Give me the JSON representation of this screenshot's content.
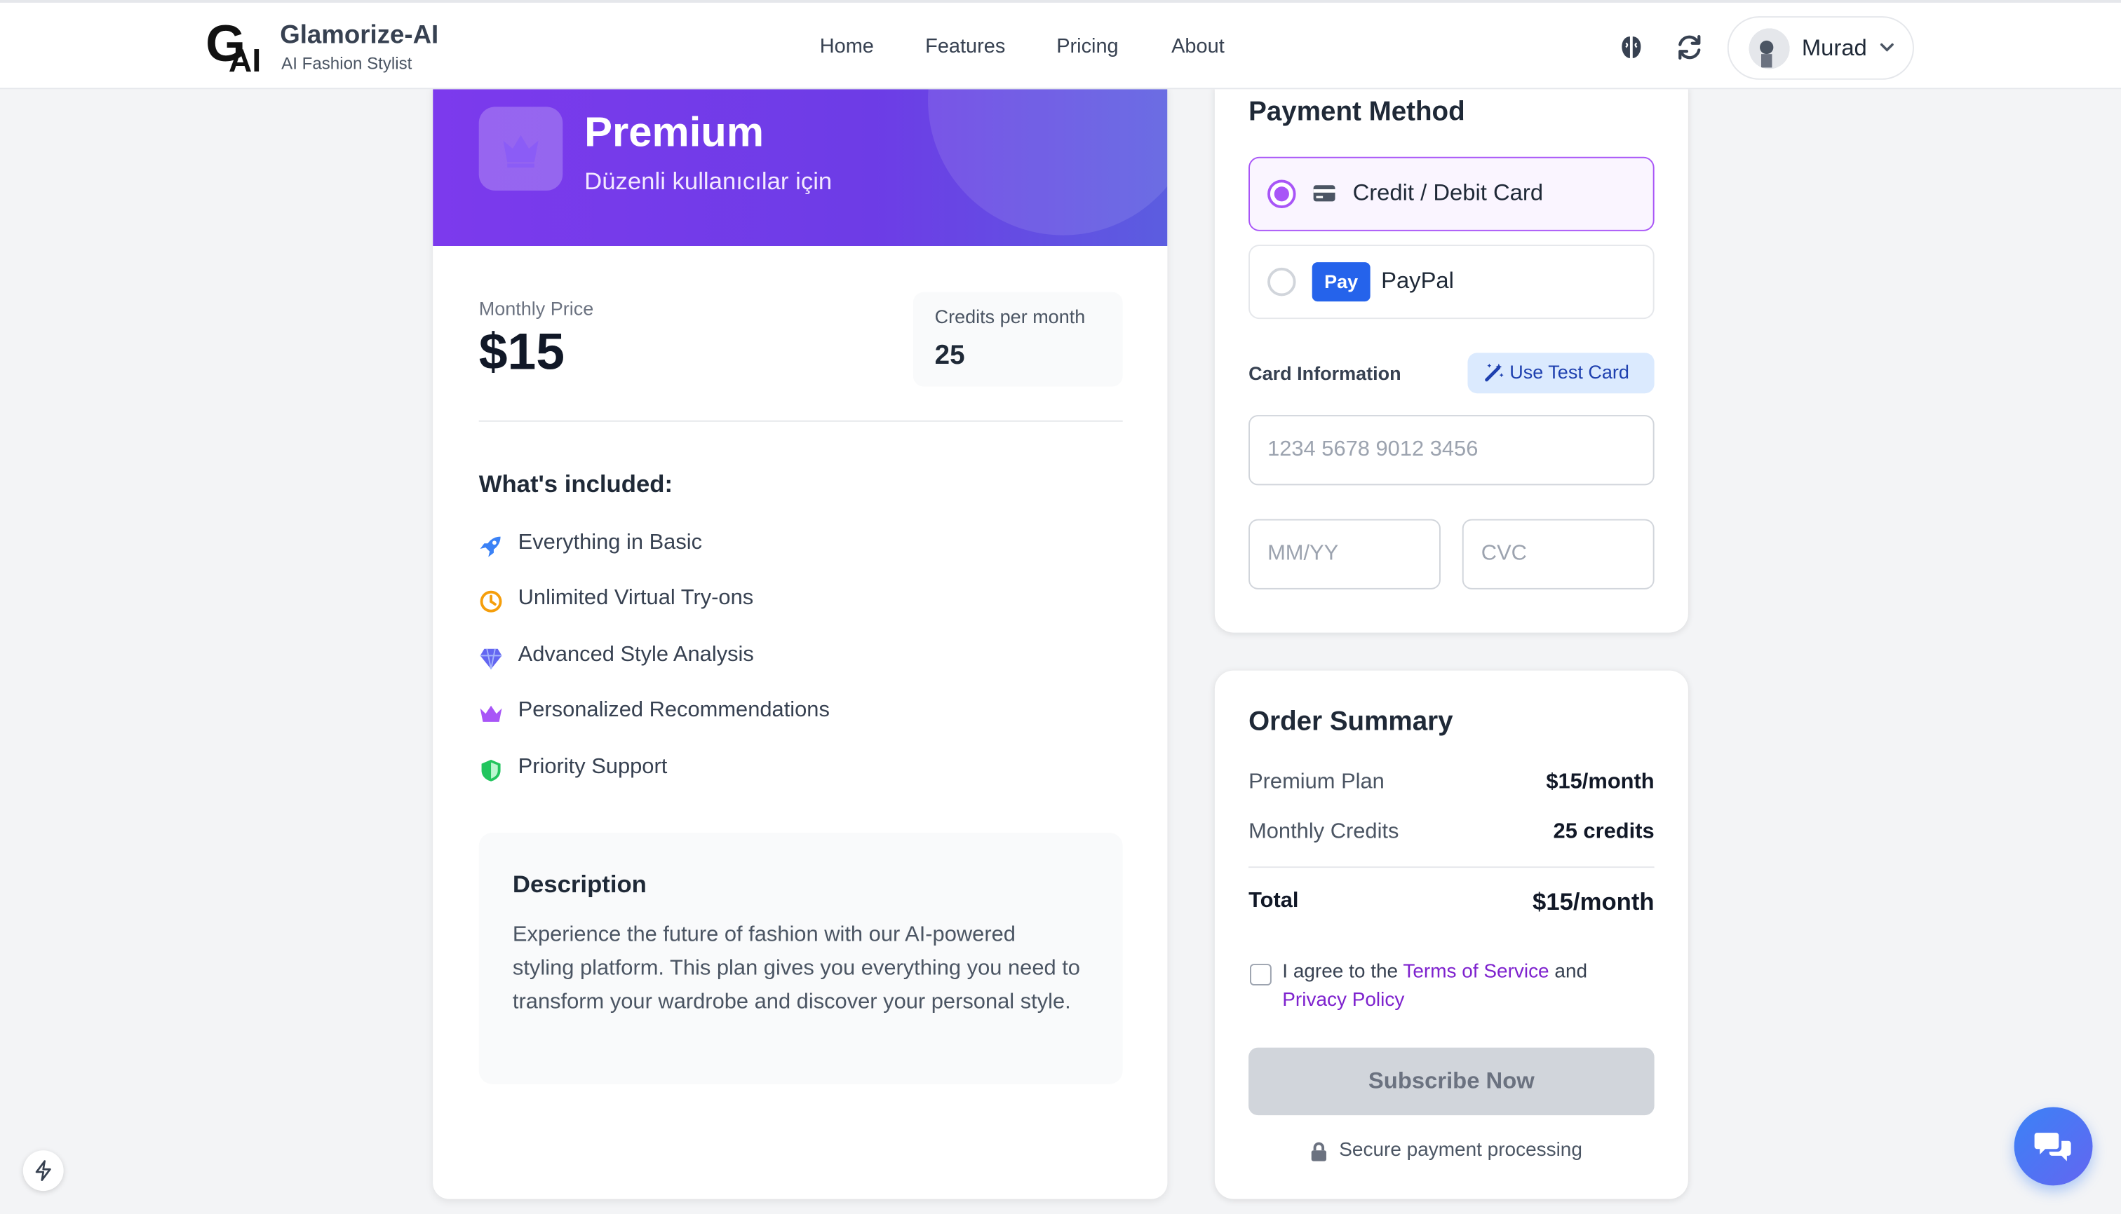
{
  "brand": {
    "name": "Glamorize-AI",
    "subtitle": "AI Fashion Stylist",
    "logo_text": "GAI"
  },
  "nav": {
    "links": [
      "Home",
      "Features",
      "Pricing",
      "About"
    ]
  },
  "header_icons": [
    "brain-icon",
    "refresh-icon"
  ],
  "user": {
    "name": "Murad"
  },
  "plan": {
    "name": "Premium",
    "tagline": "Düzenli kullanıcılar için",
    "price_label": "Monthly Price",
    "price": "$15",
    "credits_label": "Credits per month",
    "credits": "25",
    "included_title": "What's included:",
    "features": [
      {
        "label": "Everything in Basic",
        "icon": "rocket-icon",
        "color": "#3b82f6"
      },
      {
        "label": "Unlimited Virtual Try-ons",
        "icon": "clock-icon",
        "color": "#f59e0b"
      },
      {
        "label": "Advanced Style Analysis",
        "icon": "gem-icon",
        "color": "#6366f1"
      },
      {
        "label": "Personalized Recommendations",
        "icon": "crown-icon",
        "color": "#a855f7"
      },
      {
        "label": "Priority Support",
        "icon": "shield-icon",
        "color": "#22c55e"
      }
    ],
    "description_title": "Description",
    "description": "Experience the future of fashion with our AI-powered styling platform. This plan gives you everything you need to transform your wardrobe and discover your personal style."
  },
  "payment": {
    "title": "Payment Method",
    "options": [
      {
        "label": "Credit / Debit Card",
        "selected": true
      },
      {
        "label": "PayPal",
        "badge": "Pay",
        "selected": false
      }
    ],
    "card_info_label": "Card Information",
    "test_card_label": "Use Test Card",
    "card_number_placeholder": "1234 5678 9012 3456",
    "expiry_placeholder": "MM/YY",
    "cvc_placeholder": "CVC"
  },
  "summary": {
    "title": "Order Summary",
    "rows": [
      {
        "label": "Premium Plan",
        "value": "$15/month"
      },
      {
        "label": "Monthly Credits",
        "value": "25 credits"
      }
    ],
    "total_label": "Total",
    "total_value": "$15/month",
    "agree_prefix": "I agree to the",
    "terms_link": "Terms of Service",
    "agree_mid": "and",
    "privacy_link": "Privacy Policy",
    "subscribe_label": "Subscribe Now",
    "secure_text": "Secure payment processing"
  },
  "colors": {
    "accent": "#7c3aed",
    "accent_light": "#a855f7",
    "link": "#7e22ce",
    "chat_button": "#3b82f6"
  }
}
